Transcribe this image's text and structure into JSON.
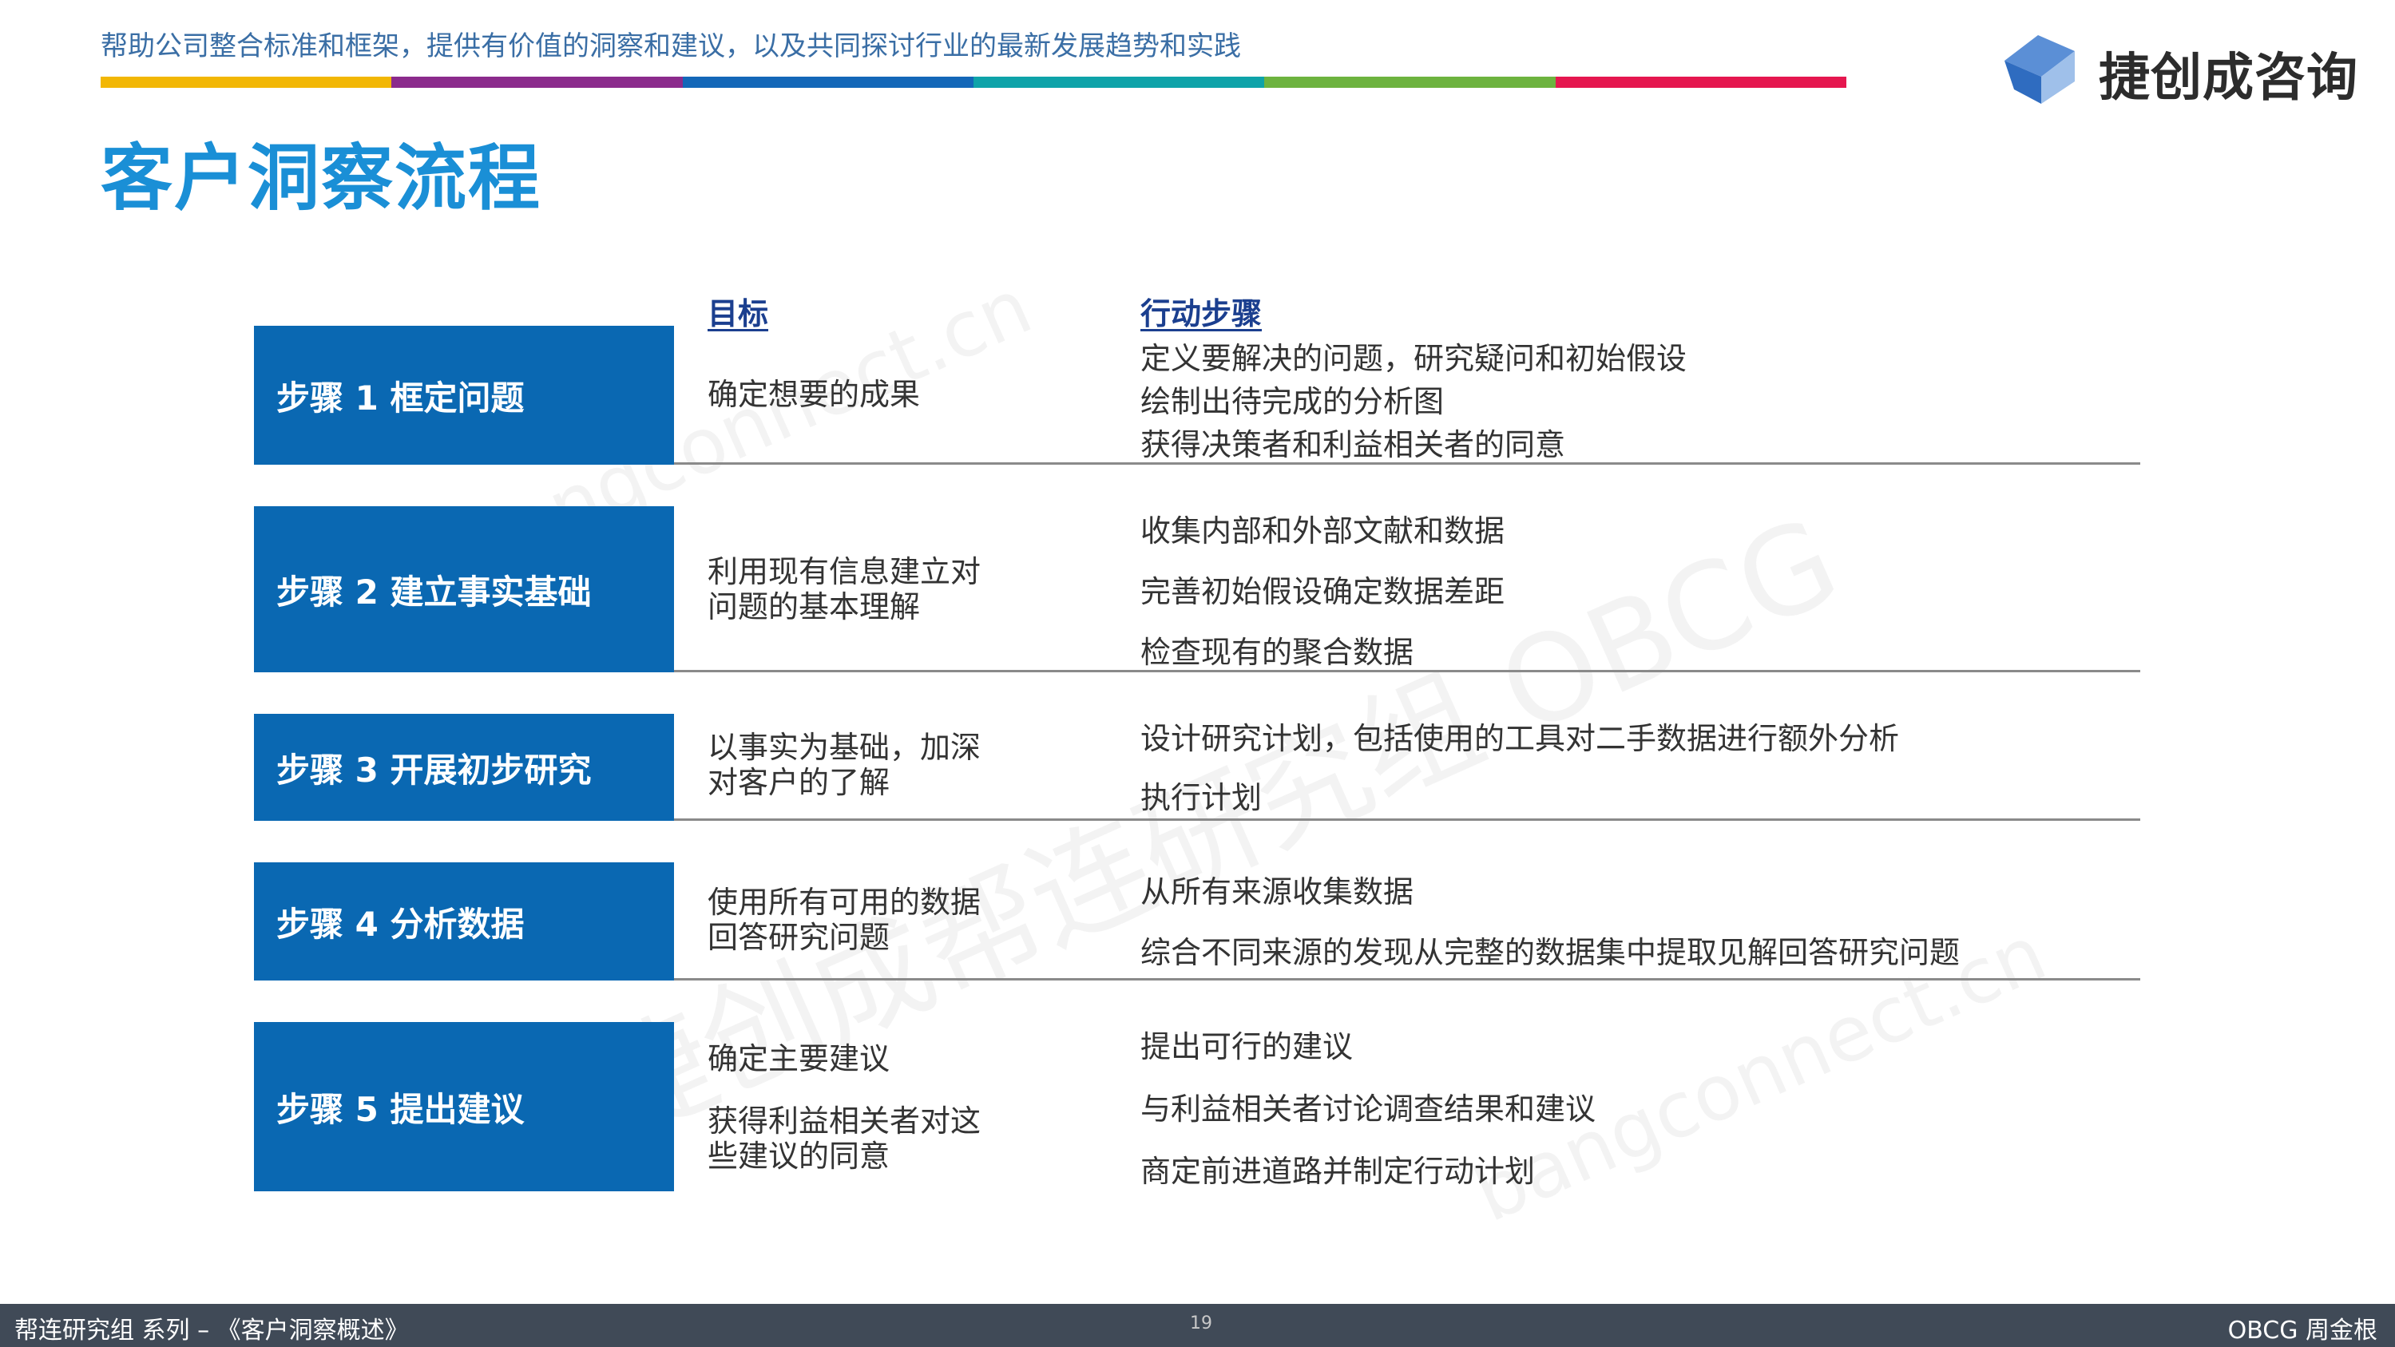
{
  "header": {
    "tagline": "帮助公司整合标准和框架，提供有价值的洞察和建议，以及共同探讨行业的最新发展趋势和实践",
    "color_bar": [
      "#f2b705",
      "#8b2b8c",
      "#1367b8",
      "#0ea3a9",
      "#6db33f",
      "#e5174f"
    ],
    "logo_text": "捷创成咨询"
  },
  "page_title": "客户洞察流程",
  "watermarks": [
    "bangconnect.cn",
    "捷创成帮连研究组 OBCG",
    "bangconnect.cn"
  ],
  "columns": {
    "goal_header": "目标",
    "actions_header": "行动步骤"
  },
  "steps": [
    {
      "label": "步骤 1 框定问题",
      "goal": [
        "确定想要的成果"
      ],
      "actions": [
        "定义要解决的问题，研究疑问和初始假设",
        "绘制出待完成的分析图",
        "获得决策者和利益相关者的同意"
      ]
    },
    {
      "label": "步骤 2 建立事实基础",
      "goal": [
        "利用现有信息建立对\n问题的基本理解"
      ],
      "actions": [
        "收集内部和外部文献和数据",
        "完善初始假设确定数据差距",
        "检查现有的聚合数据"
      ]
    },
    {
      "label": "步骤 3 开展初步研究",
      "goal": [
        "以事实为基础，加深\n对客户的了解"
      ],
      "actions": [
        "设计研究计划，包括使用的工具对二手数据进行额外分析",
        "执行计划"
      ]
    },
    {
      "label": "步骤 4 分析数据",
      "goal": [
        "使用所有可用的数据\n回答研究问题"
      ],
      "actions": [
        "从所有来源收集数据",
        "综合不同来源的发现从完整的数据集中提取见解回答研究问题"
      ]
    },
    {
      "label": "步骤 5 提出建议",
      "goal": [
        "确定主要建议",
        "获得利益相关者对这\n些建议的同意"
      ],
      "actions": [
        "提出可行的建议",
        "与利益相关者讨论调查结果和建议",
        "商定前进道路并制定行动计划"
      ]
    }
  ],
  "footer": {
    "left": "帮连研究组 系列  –  《客户洞察概述》",
    "page": "19",
    "right": "OBCG 周金根"
  }
}
